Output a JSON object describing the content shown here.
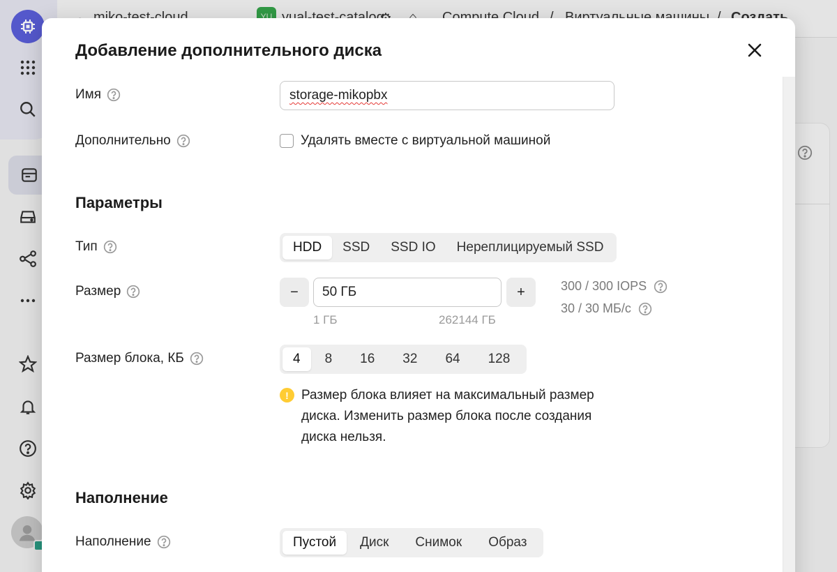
{
  "topbar": {
    "cloud": "miko-test-cloud",
    "badge": "YU",
    "catalog": "yual-test-catalog",
    "service": "Compute Cloud",
    "sep1": "/",
    "section": "Виртуальные машины",
    "sep2": "/",
    "page": "Создать"
  },
  "modal": {
    "title": "Добавление дополнительного диска",
    "name_label": "Имя",
    "name_value": "storage-mikopbx",
    "extra_label": "Дополнительно",
    "delete_with_vm_label": "Удалять вместе с виртуальной машиной",
    "delete_with_vm_checked": false,
    "params_section": "Параметры",
    "type_label": "Тип",
    "type_options": [
      "HDD",
      "SSD",
      "SSD IO",
      "Нереплицируемый SSD"
    ],
    "type_selected": "HDD",
    "size_label": "Размер",
    "size_minus": "−",
    "size_value": "50 ГБ",
    "size_plus": "+",
    "size_min": "1 ГБ",
    "size_max": "262144 ГБ",
    "iops": "300 / 300 IOPS",
    "throughput": "30 / 30 МБ/с",
    "block_label": "Размер блока, КБ",
    "block_options": [
      "4",
      "8",
      "16",
      "32",
      "64",
      "128"
    ],
    "block_selected": "4",
    "warning_icon": "!",
    "warning_text": "Размер блока влияет на максимальный размер диска. Изменить размер блока после создания диска нельзя.",
    "fill_section": "Наполнение",
    "fill_label": "Наполнение",
    "fill_options": [
      "Пустой",
      "Диск",
      "Снимок",
      "Образ"
    ],
    "fill_selected": "Пустой"
  },
  "colors": {
    "accent": "#5a5ed8",
    "warning": "#ffcc33",
    "catalog_badge": "#35a34a"
  }
}
